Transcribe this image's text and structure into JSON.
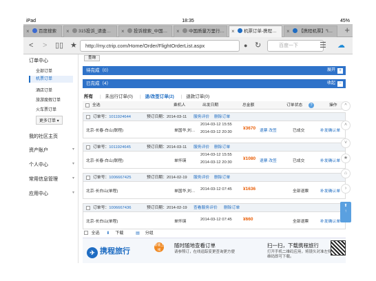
{
  "status_bar": {
    "device": "iPad",
    "time": "18:35",
    "battery": "45%"
  },
  "tabs": [
    {
      "label": "百度搜索",
      "active": false
    },
    {
      "label": "315投诉_请查…",
      "active": false
    },
    {
      "label": "投诉搜索_中国…",
      "active": false
    },
    {
      "label": "中国质量万里行…",
      "active": false
    },
    {
      "label": "机票订单-携程…",
      "active": true
    },
    {
      "label": "【携程机票】“l…",
      "active": false
    }
  ],
  "toolbar": {
    "url": "http://my.ctrip.com/Home/Order/FlightOrderList.aspx",
    "search_placeholder": "百度一下"
  },
  "sidebar": {
    "header": "订单中心",
    "items": [
      "全部订单",
      "机票订单",
      "酒店订单",
      "旅游度假订单",
      "火车票订单",
      "更多订单"
    ],
    "active_index": 1,
    "sections": [
      "我的社区主页",
      "资产账户",
      "个人中心",
      "常用信息管理",
      "应用中心"
    ]
  },
  "main": {
    "query_button": "查询",
    "pending_label": "待完成（0）",
    "pending_action": "展开",
    "done_label": "已完成（4）",
    "done_action": "收起",
    "filters": [
      "所有",
      "未出行订单(0)",
      "退/改签订单(2)",
      "退款订单(0)"
    ],
    "columns": [
      "全选",
      "乘机人",
      "出发日期",
      "总金额",
      "订单状态",
      "操作"
    ],
    "order_no_label": "订单号：",
    "booking_date_label": "预订日期：",
    "service_link": "服务评价",
    "delete_link": "删除订单",
    "view_service_link": "查看服务评价",
    "orders": [
      {
        "order_no": "1011924644",
        "booked": "2014-03-11",
        "route": "北京-长春-白山(联程)",
        "passenger": "单国华,刘…",
        "date1": "2014-03-12 15:55",
        "date2": "2014-03-12 20:30",
        "price": "¥3670",
        "actions": "退票 改签",
        "status": "已成交",
        "op": "补发确认单"
      },
      {
        "order_no": "1011924645",
        "booked": "2014-03-11",
        "route": "北京-长春-白山(联程)",
        "passenger": "单怀瑛",
        "date1": "2014-03-12 15:55",
        "date2": "2014-03-12 20:30",
        "price": "¥1080",
        "actions": "退票 改签",
        "status": "已成交",
        "op": "补发确认单"
      },
      {
        "order_no": "1006667425",
        "booked": "2014-02-19",
        "route": "北京-长白山(单程)",
        "passenger": "单国华,刘…",
        "date1": "2014-03-12 07:45",
        "date2": "",
        "price": "¥1636",
        "actions": "",
        "status": "全部退票",
        "op": "补发确认单"
      },
      {
        "order_no": "1006667436",
        "booked": "2014-02-19",
        "route": "北京-长白山(单程)",
        "passenger": "单怀瑛",
        "date1": "2014-03-12 07:45",
        "date2": "",
        "price": "¥660",
        "actions": "",
        "status": "全部退票",
        "op": "补发确认单"
      }
    ],
    "bottom_actions": [
      "全选",
      "下载",
      "分组"
    ]
  },
  "banner": {
    "logo": "携程旅行",
    "badge": "新版上线",
    "title": "随时随地查看订单",
    "desc": "请参照订，在线追踪变更查询更方便",
    "qr_title": "扫一扫，下载携程旅行",
    "qr_desc": "打开手机二维码应用，将镜头对准左侧二维码即可下载。"
  }
}
